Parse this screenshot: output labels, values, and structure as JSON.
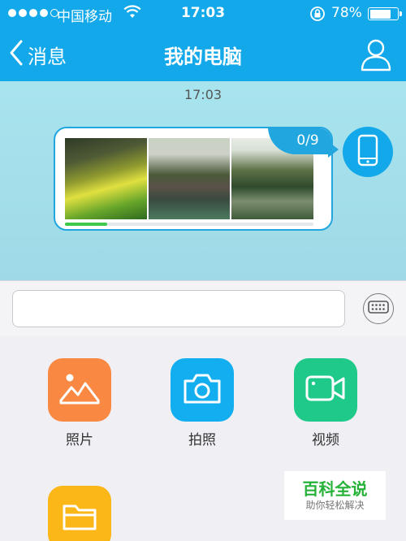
{
  "status_bar": {
    "carrier": "中国移动",
    "time": "17:03",
    "battery_percent": "78%",
    "battery_level": 0.78,
    "signal_bars": 4,
    "icons": [
      "signal-dots-icon",
      "wifi-icon",
      "rotation-lock-icon",
      "battery-icon"
    ]
  },
  "nav": {
    "back_label": "消息",
    "title": "我的电脑",
    "icons": [
      "chevron-left-icon",
      "person-icon"
    ]
  },
  "chat": {
    "timestamp": "17:03",
    "message": {
      "count": "0/9",
      "photo_count": 3,
      "upload_progress": 0.17,
      "sender_icon": "phone-icon"
    }
  },
  "input": {
    "value": "",
    "placeholder": "",
    "keyboard_icon": "keyboard-icon"
  },
  "actions": [
    {
      "label": "照片",
      "icon": "image-icon",
      "color": "#f98843"
    },
    {
      "label": "拍照",
      "icon": "camera-icon",
      "color": "#13aef0"
    },
    {
      "label": "视频",
      "icon": "video-camera-icon",
      "color": "#1ec98a"
    },
    {
      "label": "",
      "icon": "folder-icon",
      "color": "#fbb617"
    }
  ],
  "watermark": {
    "title": "百科全说",
    "subtitle": "助你轻松解决"
  },
  "colors": {
    "accent": "#12a8ea",
    "chat_bg": "#a8e4ee",
    "progress": "#3ec94c"
  }
}
